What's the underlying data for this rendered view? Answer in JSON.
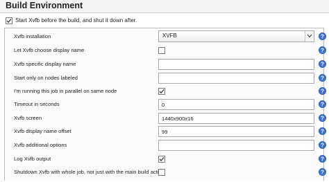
{
  "header": {
    "title": "Build Environment"
  },
  "main_option": {
    "label": "Start Xvfb before the build, and shut it down after.",
    "checked": true
  },
  "fields": [
    {
      "label": "Xvfb installation",
      "type": "select",
      "value": "XVFB"
    },
    {
      "label": "Let Xvfb choose display name",
      "type": "checkbox",
      "checked": false
    },
    {
      "label": "Xvfb specific display name",
      "type": "text",
      "value": ""
    },
    {
      "label": "Start only on nodes labeled",
      "type": "text",
      "value": ""
    },
    {
      "label": "I'm running this job in parallel on same node",
      "type": "checkbox",
      "checked": true
    },
    {
      "label": "Timeout in seconds",
      "type": "text",
      "value": "0"
    },
    {
      "label": "Xvfb screen",
      "type": "text",
      "value": "1440x900x16"
    },
    {
      "label": "Xvfb display name offset",
      "type": "text",
      "value": "99"
    },
    {
      "label": "Xvfb additional options",
      "type": "text",
      "value": ""
    },
    {
      "label": "Log Xvfb output",
      "type": "checkbox",
      "checked": true
    },
    {
      "label": "Shutdown Xvfb with whole job, not just with the main build action",
      "type": "checkbox",
      "checked": false
    }
  ],
  "colors": {
    "help_icon": "#3b6fd1",
    "checkbox_border": "#7a7a7a"
  },
  "icons": {
    "help": "help-icon",
    "dropdown": "chevron-down-icon",
    "check": "checkmark-icon"
  }
}
